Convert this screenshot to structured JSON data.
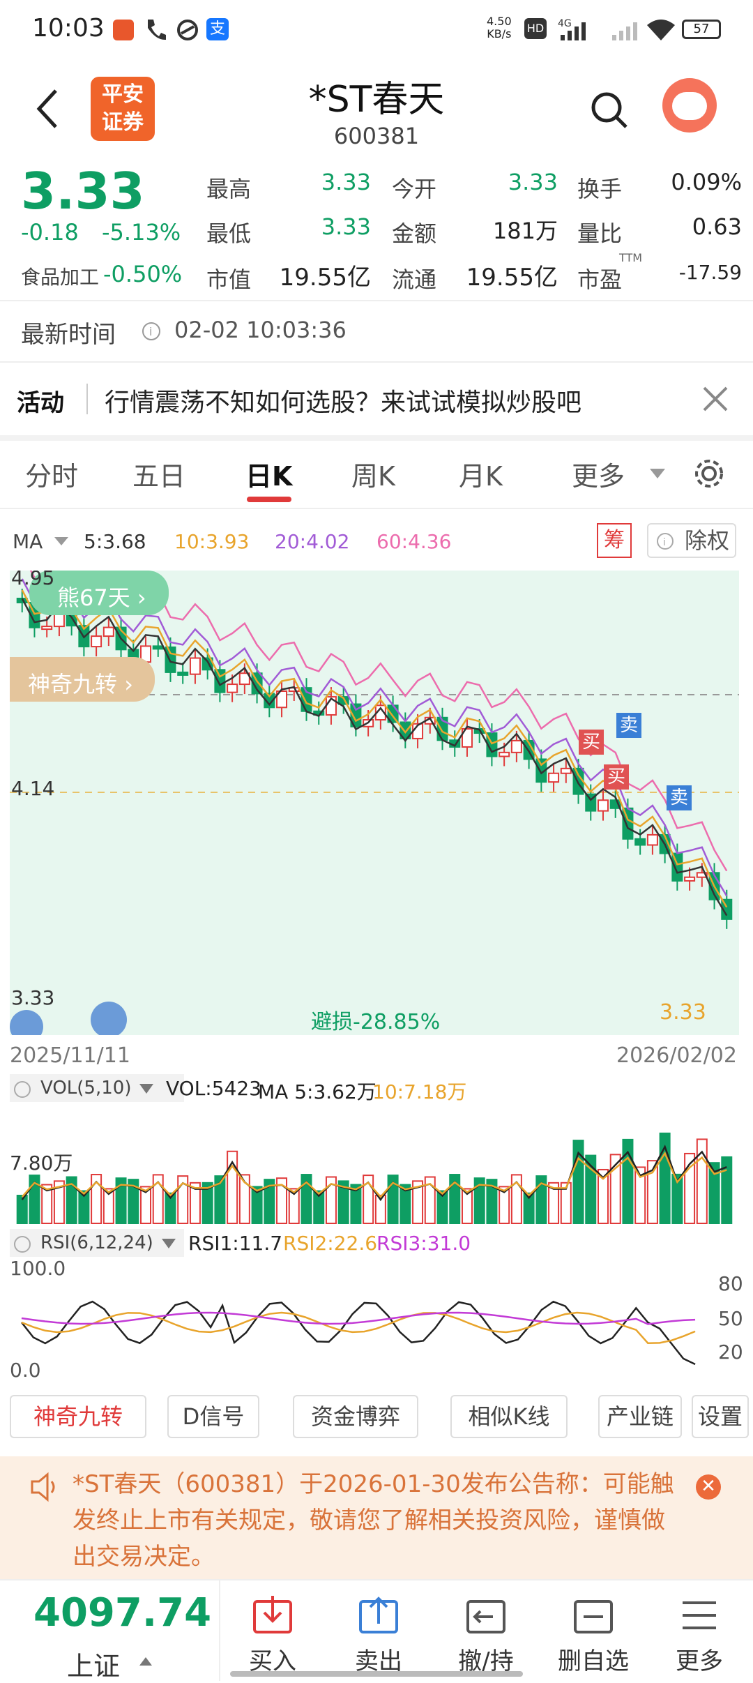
{
  "status_bar": {
    "time": "10:03",
    "net_speed": "4.50\nKB/s",
    "net_speed_top": "4.50",
    "net_speed_bot": "KB/s",
    "battery": "57"
  },
  "header": {
    "logo_line1": "平安",
    "logo_line2": "证券",
    "stock_name": "*ST春天",
    "stock_code": "600381"
  },
  "quote": {
    "price": "3.33",
    "change": "-0.18",
    "change_pct": "-5.13%",
    "sector": "食品加工",
    "sector_pct": "-0.50%",
    "high_label": "最高",
    "high": "3.33",
    "open_label": "今开",
    "open": "3.33",
    "turnover_label": "换手",
    "turnover": "0.09%",
    "low_label": "最低",
    "low": "3.33",
    "amount_label": "金额",
    "amount": "181万",
    "vol_ratio_label": "量比",
    "vol_ratio": "0.63",
    "mcap_label": "市值",
    "mcap": "19.55亿",
    "float_label": "流通",
    "float": "19.55亿",
    "pe_label": "市盈",
    "pe_sup": "TTM",
    "pe": "-17.59"
  },
  "update": {
    "label": "最新时间",
    "time": "02-02 10:03:36"
  },
  "promo": {
    "tag": "活动",
    "text": "行情震荡不知如何选股？来试试模拟炒股吧"
  },
  "tabs": {
    "t1": "分时",
    "t2": "五日",
    "t3": "日K",
    "t4": "周K",
    "t5": "月K",
    "more": "更多"
  },
  "ma_bar": {
    "label": "MA",
    "ma5": "5:3.68",
    "ma10": "10:3.93",
    "ma20": "20:4.02",
    "ma60": "60:4.36",
    "chip": "筹",
    "fq": "除权"
  },
  "kline": {
    "bear_days": "熊67天",
    "nine_turn": "神奇九转",
    "top_price": "4.95",
    "mid_price": "4.14",
    "low_price": "3.33",
    "stop_loss": "避损-28.85%",
    "last_price": "3.33",
    "buy": "买",
    "sell": "卖",
    "start_date": "2025/11/11",
    "end_date": "2026/02/02"
  },
  "chart_data": [
    {
      "type": "bar",
      "title": "VOL(5,10)",
      "vol": "VOL:5423",
      "ma5": "MA 5:3.62万",
      "ma10": "10:7.18万",
      "ytick": "7.80万"
    },
    {
      "type": "line",
      "title": "RSI(6,12,24)",
      "rsi1": "RSI1:11.7",
      "rsi2": "RSI2:22.6",
      "rsi3": "RSI3:31.0",
      "ylim_labels": [
        "100.0",
        "0.0"
      ],
      "right_ticks": [
        "80",
        "50",
        "20"
      ]
    }
  ],
  "tool_buttons": {
    "b1": "神奇九转",
    "b2": "D信号",
    "b3": "资金博弈",
    "b4": "相似K线",
    "b5": "产业链",
    "b6": "设置"
  },
  "notice": {
    "text": "*ST春天（600381）于2026-01-30发布公告称：可能触发终止上市有关规定，敬请您了解相关投资风险，谨慎做出交易决定。"
  },
  "bottom": {
    "index_value": "4097.74",
    "index_name": "上证",
    "buy": "买入",
    "sell": "卖出",
    "cancel": "撤/持",
    "remove": "删自选",
    "more": "更多"
  }
}
